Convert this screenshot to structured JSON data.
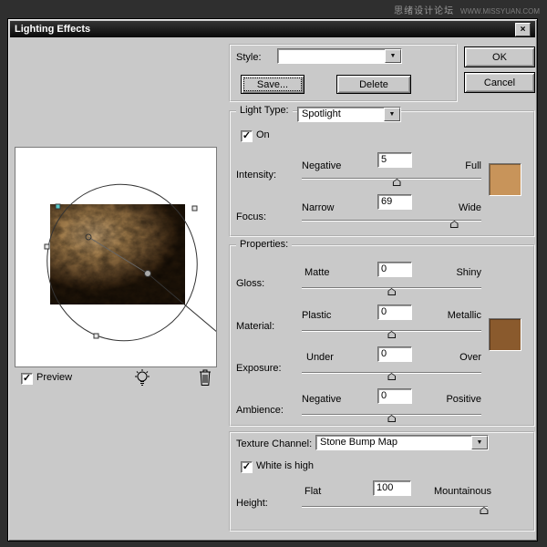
{
  "watermark": {
    "site": "思绪设计论坛",
    "url": "WWW.MISSYUAN.COM"
  },
  "dialog": {
    "title": "Lighting Effects"
  },
  "style": {
    "label": "Style:",
    "value": "",
    "save": "Save...",
    "del": "Delete"
  },
  "actions": {
    "ok": "OK",
    "cancel": "Cancel"
  },
  "light": {
    "group": "Light Type:",
    "type": "Spotlight",
    "on": "On",
    "intensity": {
      "label": "Intensity:",
      "left": "Negative",
      "right": "Full",
      "value": "5",
      "percent": 53
    },
    "focus": {
      "label": "Focus:",
      "left": "Narrow",
      "right": "Wide",
      "value": "69",
      "percent": 85
    }
  },
  "props": {
    "group": "Properties:",
    "gloss": {
      "label": "Gloss:",
      "left": "Matte",
      "right": "Shiny",
      "value": "0",
      "percent": 50
    },
    "material": {
      "label": "Material:",
      "left": "Plastic",
      "right": "Metallic",
      "value": "0",
      "percent": 50
    },
    "exposure": {
      "label": "Exposure:",
      "left": "Under",
      "right": "Over",
      "value": "0",
      "percent": 50
    },
    "ambience": {
      "label": "Ambience:",
      "left": "Negative",
      "right": "Positive",
      "value": "0",
      "percent": 50
    }
  },
  "texture": {
    "group": "Texture Channel:",
    "value": "Stone Bump Map",
    "white": "White is high",
    "height": {
      "label": "Height:",
      "left": "Flat",
      "right": "Mountainous",
      "value": "100",
      "percent": 98
    }
  },
  "preview": {
    "label": "Preview"
  },
  "colors": {
    "intensity_swatch": "#c8945a",
    "props_swatch": "#8a5a2d"
  }
}
